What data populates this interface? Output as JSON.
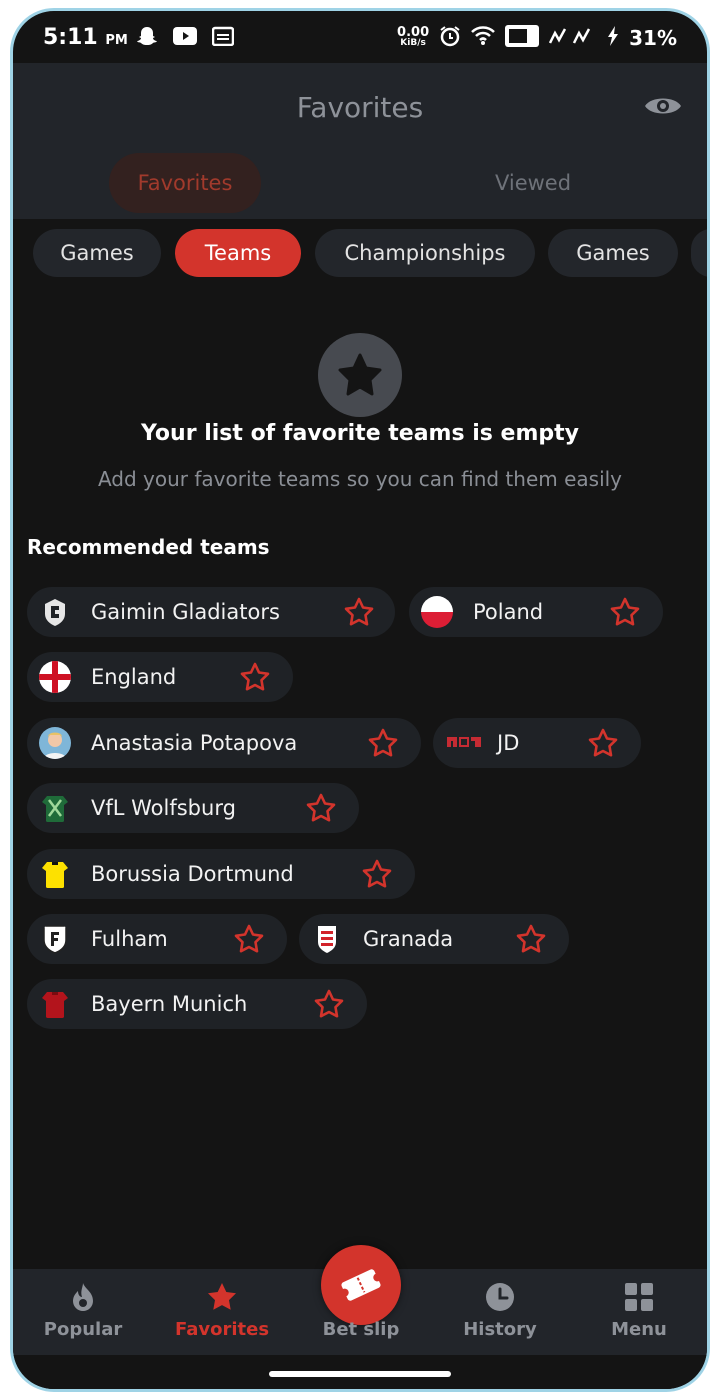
{
  "status_bar": {
    "time": "5:11",
    "ampm": "PM",
    "net_speed": "0.00",
    "net_unit": "KiB/s",
    "battery": "31%"
  },
  "header": {
    "title": "Favorites",
    "tabs": [
      {
        "label": "Favorites",
        "active": true
      },
      {
        "label": "Viewed",
        "active": false
      }
    ]
  },
  "filter_chips": [
    {
      "label": "Games",
      "active": false
    },
    {
      "label": "Teams",
      "active": true
    },
    {
      "label": "Championships",
      "active": false
    },
    {
      "label": "Games",
      "active": false
    }
  ],
  "empty_state": {
    "icon": "star-icon",
    "title": "Your list of favorite teams is empty",
    "subtitle": "Add your favorite teams so you can find them easily"
  },
  "recommended": {
    "title": "Recommended teams",
    "teams": [
      {
        "name": "Gaimin Gladiators",
        "logo": "gaimin-gladiators-logo"
      },
      {
        "name": "Poland",
        "logo": "poland-flag"
      },
      {
        "name": "England",
        "logo": "england-flag"
      },
      {
        "name": "Anastasia Potapova",
        "logo": "player-avatar"
      },
      {
        "name": "JD",
        "logo": "jd-gaming-logo"
      },
      {
        "name": "VfL Wolfsburg",
        "logo": "wolfsburg-jersey"
      },
      {
        "name": "Borussia Dortmund",
        "logo": "dortmund-jersey"
      },
      {
        "name": "Fulham",
        "logo": "fulham-crest"
      },
      {
        "name": "Granada",
        "logo": "granada-crest"
      },
      {
        "name": "Bayern Munich",
        "logo": "bayern-jersey"
      }
    ]
  },
  "bottom_nav": [
    {
      "label": "Popular",
      "icon": "flame-icon",
      "active": false
    },
    {
      "label": "Favorites",
      "icon": "star-icon",
      "active": true
    },
    {
      "label": "Bet slip",
      "icon": "ticket-icon",
      "active": false
    },
    {
      "label": "History",
      "icon": "clock-icon",
      "active": false
    },
    {
      "label": "Menu",
      "icon": "grid-icon",
      "active": false
    }
  ],
  "colors": {
    "accent": "#d3342c",
    "background": "#141414",
    "surface": "#22252a"
  }
}
